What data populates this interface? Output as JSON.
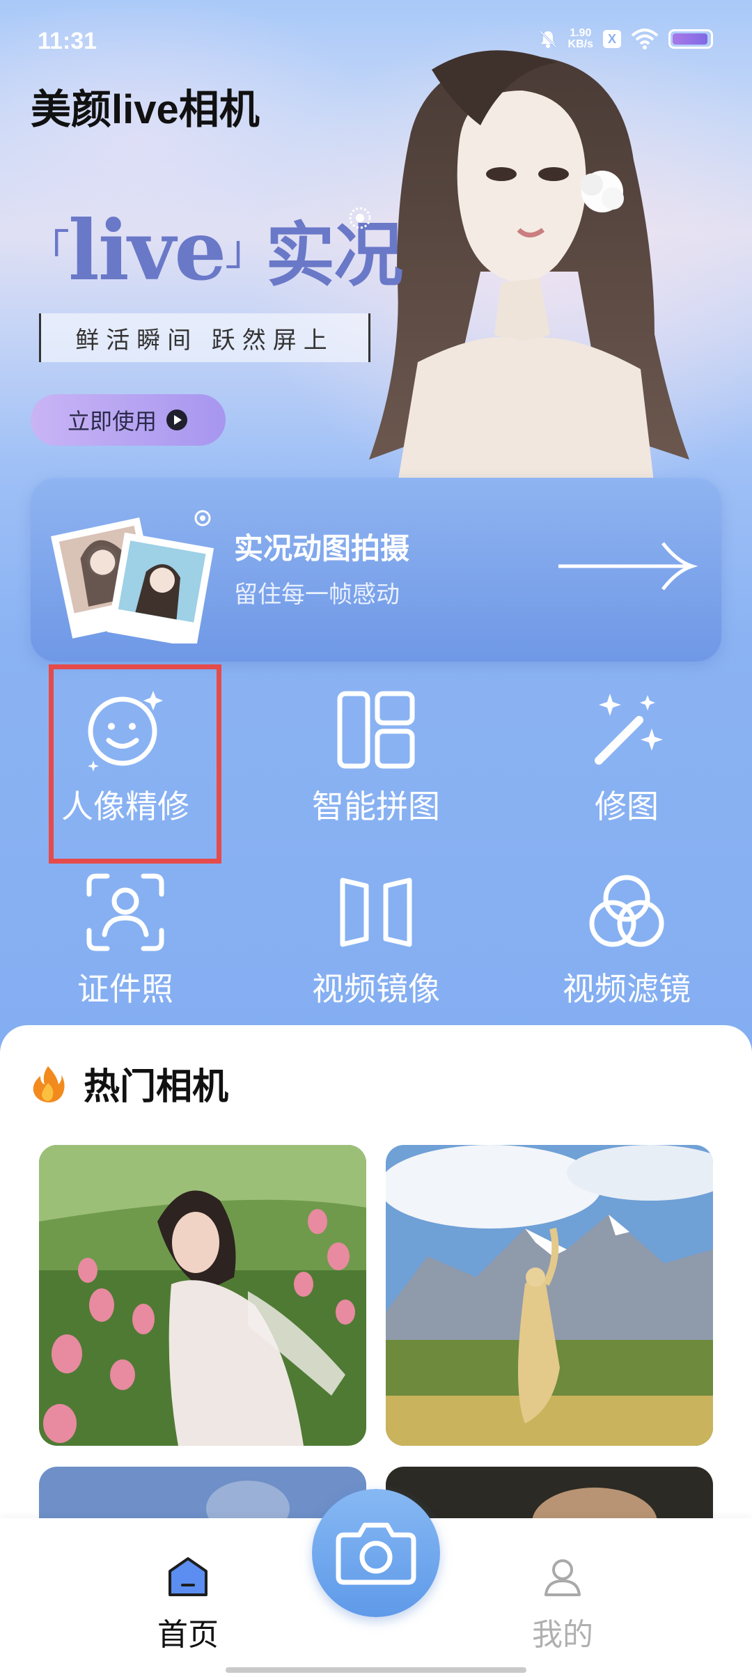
{
  "status_bar": {
    "time": "11:31",
    "network_speed_value": "1.90",
    "network_speed_unit": "KB/s",
    "notification_badge": "X"
  },
  "app": {
    "title": "美颜live相机"
  },
  "hero": {
    "title_latin": "live",
    "title_cn": "实况",
    "subtitle": "鲜活瞬间  跃然屏上",
    "cta_label": "立即使用"
  },
  "live_card": {
    "title": "实况动图拍摄",
    "subtitle": "留住每一帧感动"
  },
  "tools": [
    {
      "label": "人像精修",
      "icon": "smile-sparkle-icon"
    },
    {
      "label": "智能拼图",
      "icon": "collage-layout-icon"
    },
    {
      "label": "修图",
      "icon": "magic-wand-icon"
    },
    {
      "label": "证件照",
      "icon": "face-scan-icon"
    },
    {
      "label": "视频镜像",
      "icon": "mirror-icon"
    },
    {
      "label": "视频滤镜",
      "icon": "filter-circles-icon"
    }
  ],
  "hot_section": {
    "title": "热门相机",
    "icon": "fire-icon"
  },
  "bottom_nav": {
    "home_label": "首页",
    "mine_label": "我的",
    "active": "home"
  },
  "colors": {
    "accent_blue": "#6f98e6",
    "highlight_red": "#e54b4b",
    "hero_title": "#6a78c8",
    "cta_purple": "#a796ef"
  }
}
